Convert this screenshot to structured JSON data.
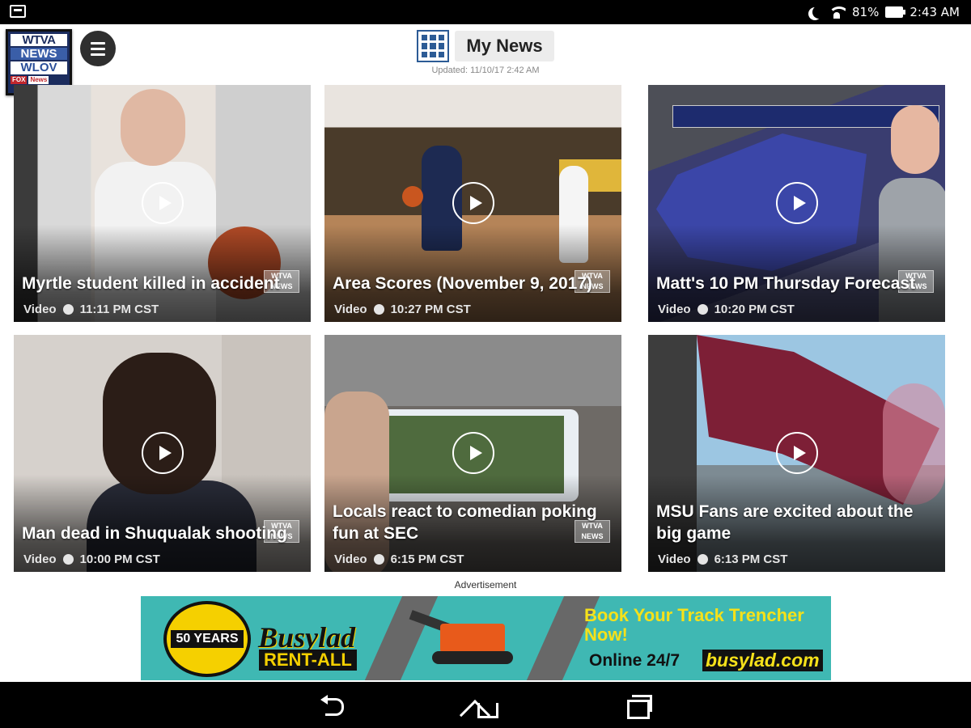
{
  "status_bar": {
    "battery": "81%",
    "time": "2:43 AM",
    "icons": [
      "notification-icon",
      "moon-icon",
      "wifi-icon",
      "battery-icon"
    ]
  },
  "header": {
    "logo": {
      "line1": "WTVA",
      "line2": "NEWS",
      "line3": "WLOV",
      "line4a": "FOX",
      "line4b": "News"
    },
    "title": "My News",
    "updated": "Updated: 11/10/17 2:42 AM"
  },
  "cards": [
    {
      "title": "Myrtle student killed in accident",
      "type": "Video",
      "time": "11:11 PM CST"
    },
    {
      "title": "Area Scores (November 9, 2017)",
      "type": "Video",
      "time": "10:27 PM CST"
    },
    {
      "title": "Matt's 10 PM Thursday Forecast",
      "type": "Video",
      "time": "10:20 PM CST"
    },
    {
      "title": "Man dead in Shuqualak shooting",
      "type": "Video",
      "time": "10:00 PM CST"
    },
    {
      "title": "Locals react to comedian poking fun at SEC",
      "type": "Video",
      "time": "6:15 PM CST"
    },
    {
      "title": "MSU Fans are excited about the big game",
      "type": "Video",
      "time": "6:13 PM CST"
    }
  ],
  "watermark": {
    "line1": "WTVA",
    "line2": "NEWS"
  },
  "advertisement": {
    "label": "Advertisement",
    "badge": "50 YEARS",
    "brand": "Busylad",
    "rent": "RENT-ALL",
    "headline": "Book Your Track Trencher Now!",
    "online": "Online 24/7",
    "url": "busylad.com"
  },
  "nav": {
    "icons": [
      "back-icon",
      "home-icon",
      "recent-apps-icon"
    ]
  },
  "colors": {
    "accent": "#2c5b95",
    "ad_background": "#3fb8b3",
    "ad_yellow": "#f5e11a"
  }
}
